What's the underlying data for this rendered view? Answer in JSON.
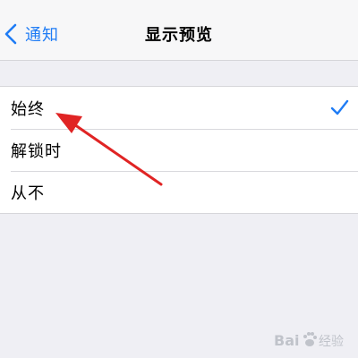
{
  "header": {
    "back_label": "通知",
    "title": "显示预览"
  },
  "options": [
    {
      "label": "始终",
      "selected": true
    },
    {
      "label": "解锁时",
      "selected": false
    },
    {
      "label": "从不",
      "selected": false
    }
  ],
  "watermark": {
    "text": "Bai 经验"
  },
  "colors": {
    "accent": "#1f7cf5",
    "background": "#efeff4",
    "annotation_arrow": "#e02424"
  },
  "icons": {
    "back": "chevron-left-icon",
    "selected": "checkmark-icon",
    "annotation": "red-arrow-icon",
    "watermark": "baidu-paw-logo"
  }
}
